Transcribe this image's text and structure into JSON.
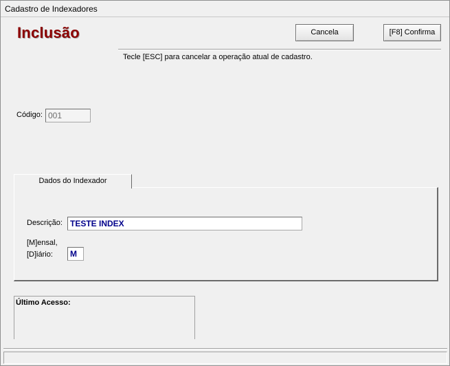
{
  "window": {
    "title": "Cadastro de Indexadores"
  },
  "header": {
    "mode_title": "Inclusão",
    "cancel_button": "Cancela",
    "confirm_button": "[F8]  Confirma",
    "hint": "Tecle [ESC] para cancelar a operação atual de cadastro."
  },
  "form": {
    "code_label": "Código:",
    "code_value": "001",
    "tab_label": "Dados do Indexador",
    "description_label": "Descrição:",
    "description_value": "TESTE INDEX",
    "type_label_line1": "[M]ensal,",
    "type_label_line2": "[D]iário:",
    "type_value": "M"
  },
  "footer": {
    "last_access_label": "Último Acesso:"
  }
}
